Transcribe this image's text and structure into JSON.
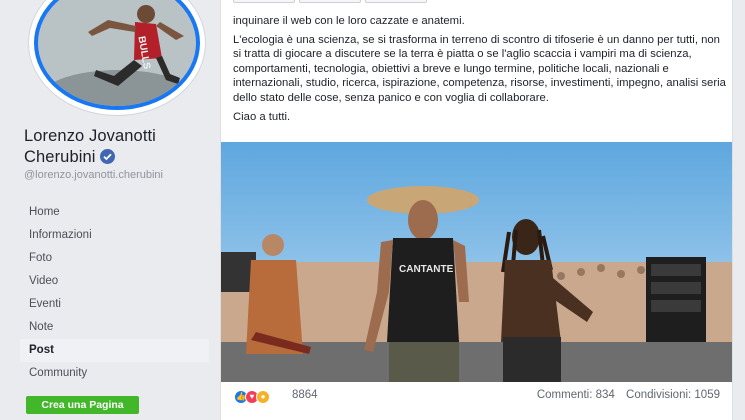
{
  "profile": {
    "name": "Lorenzo Jovanotti Cherubini",
    "handle": "@lorenzo.jovanotti.cherubini"
  },
  "nav": {
    "items": [
      {
        "label": "Home"
      },
      {
        "label": "Informazioni"
      },
      {
        "label": "Foto"
      },
      {
        "label": "Video"
      },
      {
        "label": "Eventi"
      },
      {
        "label": "Note"
      },
      {
        "label": "Post"
      },
      {
        "label": "Community"
      }
    ],
    "active": "Post",
    "create_page_label": "Crea una Pagina"
  },
  "post": {
    "text_line1": "inquinare il web con le loro cazzate e anatemi.",
    "text_para2": "L'ecologia è una scienza, se si trasforma in terreno di scontro di tifoserie è un danno per tutti, non si tratta di giocare a discutere se la terra è piatta o se l'aglio scaccia i vampiri ma di scienza, comportamenti, tecnologia, obiettivi a breve e lungo termine, politiche locali, nazionali e internazionali, studio, ricerca, ispirazione, competenza, risorse, investimenti, impegno, analisi seria dello stato delle cose, senza panico e con voglia di collaborare.",
    "text_para3": "Ciao a tutti.",
    "photo_shirt_text": "CANTANTE"
  },
  "stats": {
    "reaction_count": "8864",
    "comments": "Commenti: 834",
    "shares": "Condivisioni: 1059"
  },
  "colors": {
    "accent": "#4267b2",
    "create_button": "#42b72a",
    "avatar_ring": "#1877f2"
  }
}
